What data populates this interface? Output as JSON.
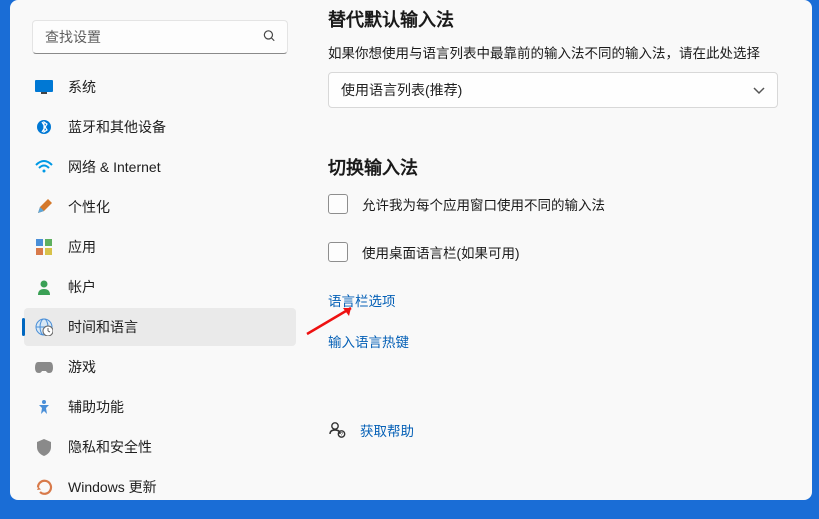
{
  "search": {
    "placeholder": "查找设置"
  },
  "sidebar": {
    "items": [
      {
        "label": "系统",
        "icon": "display-icon"
      },
      {
        "label": "蓝牙和其他设备",
        "icon": "bluetooth-icon"
      },
      {
        "label": "网络 & Internet",
        "icon": "wifi-icon"
      },
      {
        "label": "个性化",
        "icon": "personalize-icon"
      },
      {
        "label": "应用",
        "icon": "apps-icon"
      },
      {
        "label": "帐户",
        "icon": "account-icon"
      },
      {
        "label": "时间和语言",
        "icon": "time-language-icon"
      },
      {
        "label": "游戏",
        "icon": "gaming-icon"
      },
      {
        "label": "辅助功能",
        "icon": "accessibility-icon"
      },
      {
        "label": "隐私和安全性",
        "icon": "privacy-icon"
      },
      {
        "label": "Windows 更新",
        "icon": "update-icon"
      }
    ],
    "activeIndex": 6
  },
  "main": {
    "section1": {
      "title": "替代默认输入法",
      "desc": "如果你想使用与语言列表中最靠前的输入法不同的输入法，请在此处选择",
      "select_value": "使用语言列表(推荐)"
    },
    "section2": {
      "title": "切换输入法",
      "checks": [
        {
          "label": "允许我为每个应用窗口使用不同的输入法"
        },
        {
          "label": "使用桌面语言栏(如果可用)"
        }
      ],
      "links": [
        {
          "label": "语言栏选项"
        },
        {
          "label": "输入语言热键"
        }
      ]
    },
    "help": {
      "label": "获取帮助"
    }
  }
}
